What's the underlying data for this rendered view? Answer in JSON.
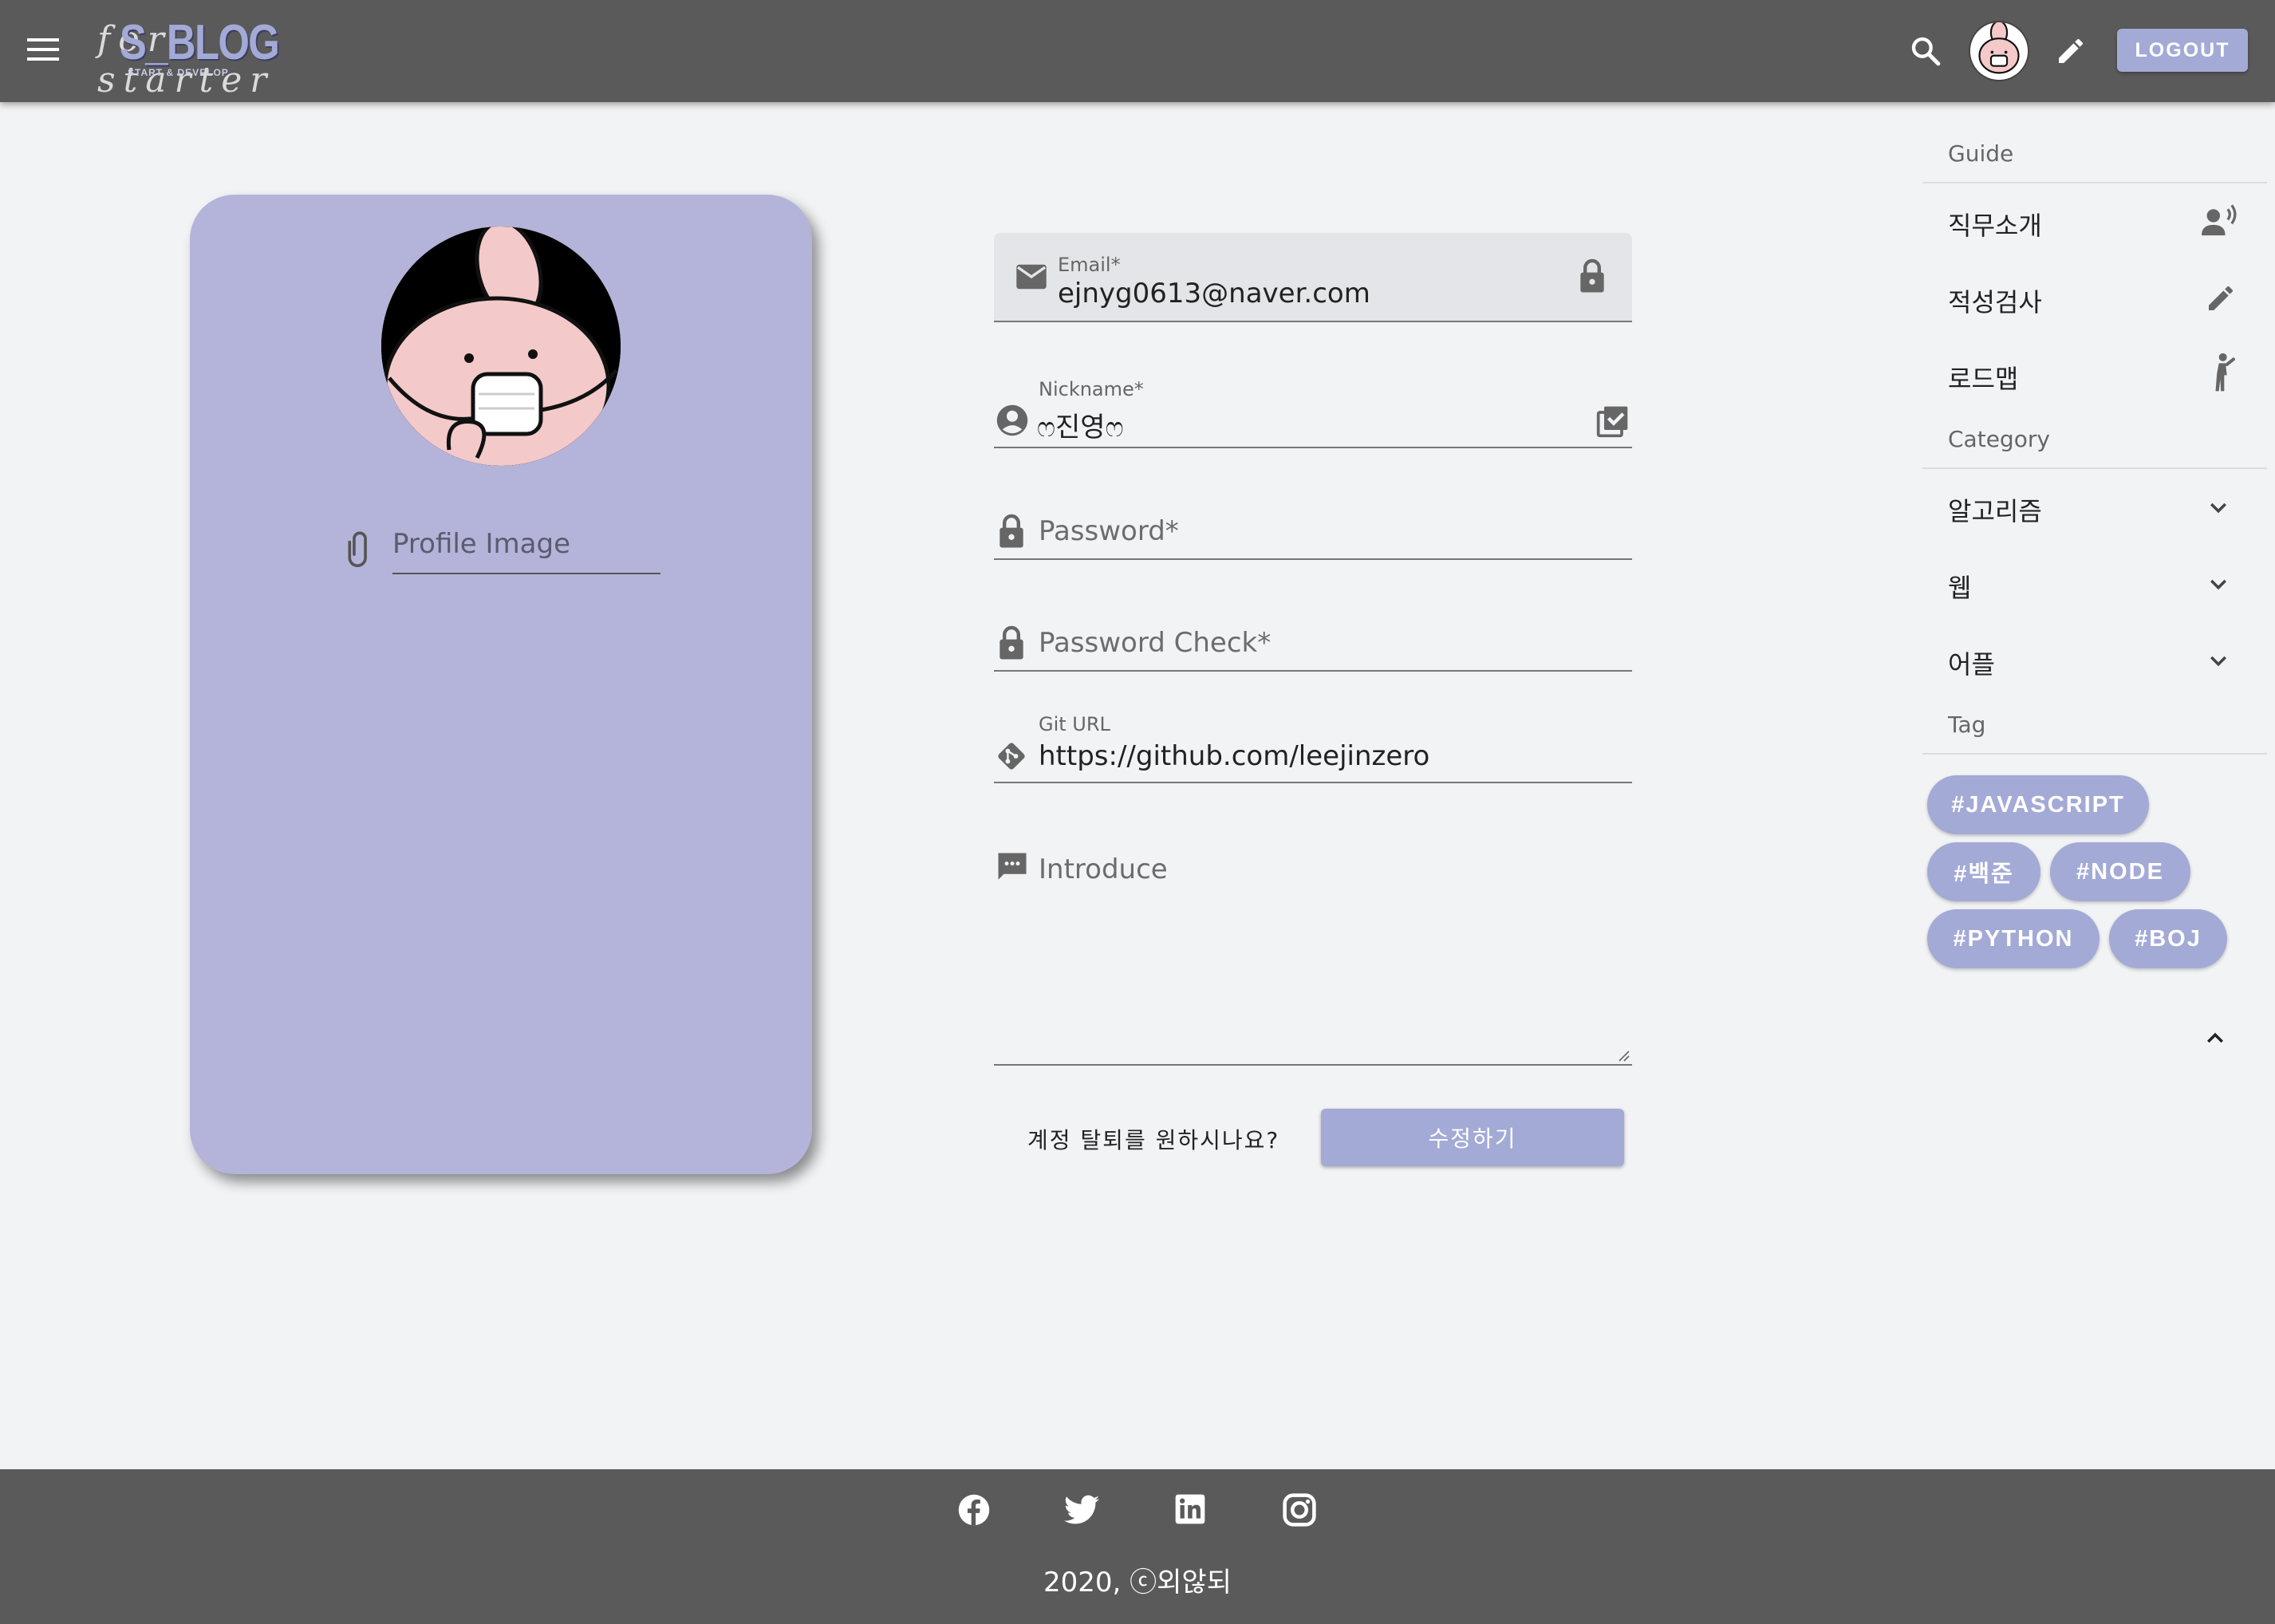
{
  "header": {
    "logo_script": "for starter",
    "logo_text": "S_BLOG",
    "logo_subtext": "START & DEVELOP",
    "logout_label": "LOGOUT",
    "icons": [
      "menu-icon",
      "search-icon",
      "avatar",
      "pencil-icon"
    ]
  },
  "profile": {
    "image_label": "Profile Image",
    "icons": [
      "paperclip-icon"
    ]
  },
  "form": {
    "email_label": "Email*",
    "email_value": "ejnyg0613@naver.com",
    "nickname_label": "Nickname*",
    "nickname_value": "ෆ진영ෆ",
    "password_placeholder": "Password*",
    "password_check_placeholder": "Password Check*",
    "git_label": "Git URL",
    "git_value": "https://github.com/leejinzero",
    "introduce_placeholder": "Introduce",
    "delete_account_text": "계정 탈퇴를 원하시나요?",
    "submit_label": "수정하기"
  },
  "sidebar": {
    "guide_heading": "Guide",
    "guide_items": [
      {
        "label": "직무소개",
        "icon": "record-voice-icon"
      },
      {
        "label": "적성검사",
        "icon": "pencil-icon"
      },
      {
        "label": "로드맵",
        "icon": "hiking-person-icon"
      }
    ],
    "category_heading": "Category",
    "category_items": [
      {
        "label": "알고리즘",
        "icon": "chevron-down-icon"
      },
      {
        "label": "웹",
        "icon": "chevron-down-icon"
      },
      {
        "label": "어플",
        "icon": "chevron-down-icon"
      }
    ],
    "tag_heading": "Tag",
    "tags": [
      "#JAVASCRIPT",
      "#백준",
      "#NODE",
      "#PYTHON",
      "#BOJ"
    ],
    "collapse_icon": "chevron-up-icon"
  },
  "footer": {
    "copyright": "2020, ⓒ외않되",
    "social_icons": [
      "facebook-icon",
      "twitter-icon",
      "linkedin-icon",
      "instagram-icon"
    ]
  },
  "colors": {
    "topbar": "#5a5a5a",
    "accent": "#a4aad6",
    "card": "#b4b4da",
    "background": "#f2f3f5"
  }
}
